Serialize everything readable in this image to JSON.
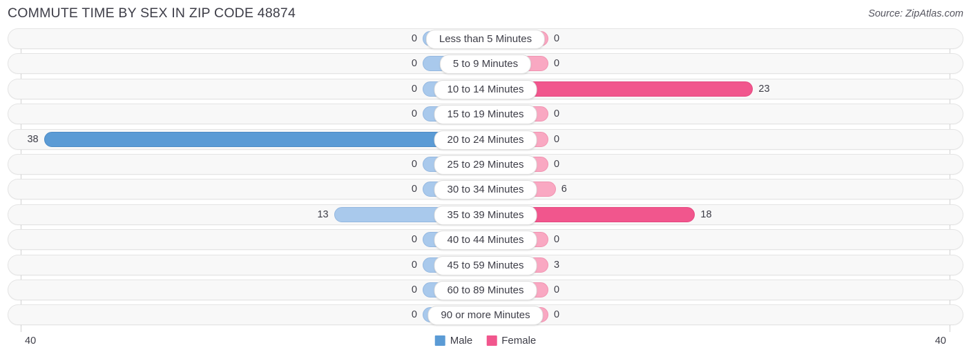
{
  "header": {
    "title": "COMMUTE TIME BY SEX IN ZIP CODE 48874",
    "source": "Source: ZipAtlas.com"
  },
  "legend": {
    "male_label": "Male",
    "female_label": "Female",
    "male_color": "#5b9bd5",
    "female_color": "#f1568d"
  },
  "axis": {
    "left_end": "40",
    "right_end": "40",
    "max": 40
  },
  "chart_data": {
    "type": "bar",
    "orientation": "horizontal-diverging",
    "title": "COMMUTE TIME BY SEX IN ZIP CODE 48874",
    "xlabel": "",
    "ylabel": "",
    "xlim": [
      40,
      40
    ],
    "grid": false,
    "legend_position": "bottom-center",
    "categories": [
      "Less than 5 Minutes",
      "5 to 9 Minutes",
      "10 to 14 Minutes",
      "15 to 19 Minutes",
      "20 to 24 Minutes",
      "25 to 29 Minutes",
      "30 to 34 Minutes",
      "35 to 39 Minutes",
      "40 to 44 Minutes",
      "45 to 59 Minutes",
      "60 to 89 Minutes",
      "90 or more Minutes"
    ],
    "series": [
      {
        "name": "Male",
        "values": [
          0,
          0,
          0,
          0,
          38,
          0,
          0,
          13,
          0,
          0,
          0,
          0
        ]
      },
      {
        "name": "Female",
        "values": [
          0,
          0,
          23,
          0,
          0,
          0,
          6,
          18,
          0,
          3,
          0,
          0
        ]
      }
    ]
  },
  "rows": [
    {
      "label": "Less than 5 Minutes",
      "male": "0",
      "female": "0"
    },
    {
      "label": "5 to 9 Minutes",
      "male": "0",
      "female": "0"
    },
    {
      "label": "10 to 14 Minutes",
      "male": "0",
      "female": "23"
    },
    {
      "label": "15 to 19 Minutes",
      "male": "0",
      "female": "0"
    },
    {
      "label": "20 to 24 Minutes",
      "male": "38",
      "female": "0"
    },
    {
      "label": "25 to 29 Minutes",
      "male": "0",
      "female": "0"
    },
    {
      "label": "30 to 34 Minutes",
      "male": "0",
      "female": "6"
    },
    {
      "label": "35 to 39 Minutes",
      "male": "13",
      "female": "18"
    },
    {
      "label": "40 to 44 Minutes",
      "male": "0",
      "female": "0"
    },
    {
      "label": "45 to 59 Minutes",
      "male": "0",
      "female": "3"
    },
    {
      "label": "60 to 89 Minutes",
      "male": "0",
      "female": "0"
    },
    {
      "label": "90 or more Minutes",
      "male": "0",
      "female": "0"
    }
  ]
}
